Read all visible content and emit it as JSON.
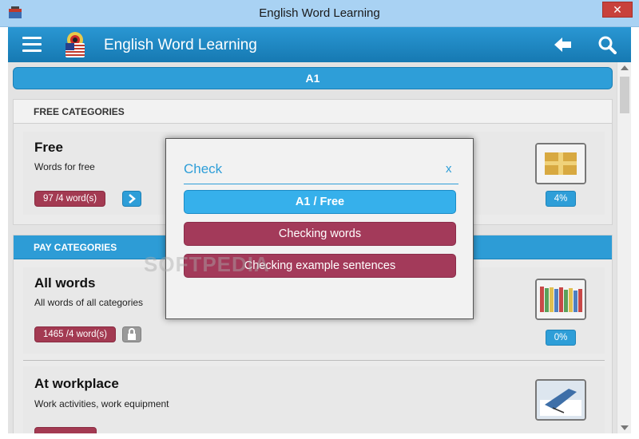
{
  "window": {
    "title": "English Word Learning",
    "close_glyph": "✕"
  },
  "header": {
    "title": "English Word Learning",
    "menu_icon": "hamburger-icon",
    "back_icon": "back-arrow-icon",
    "search_icon": "search-icon"
  },
  "level": {
    "label": "A1"
  },
  "free_section": {
    "title": "FREE CATEGORIES",
    "cards": [
      {
        "title": "Free",
        "description": "Words for free",
        "count": "97 /4 word(s)",
        "progress": "4%",
        "action_icon": "chevron-right-icon"
      }
    ]
  },
  "pay_section": {
    "title": "PAY CATEGORIES",
    "cards": [
      {
        "title": "All words",
        "description": "All words of all categories",
        "count": "1465 /4 word(s)",
        "progress": "0%",
        "action_icon": "lock-icon"
      },
      {
        "title": "At workplace",
        "description": "Work activities, work equipment"
      }
    ]
  },
  "dialog": {
    "title": "Check",
    "close_label": "x",
    "buttons": [
      "A1 / Free",
      "Checking words",
      "Checking example sentences"
    ]
  },
  "watermark": "SOFTPEDIA",
  "colors": {
    "accent_blue": "#2e9ed8",
    "badge_red": "#a33a52",
    "header_blue": "#1b87c2"
  }
}
